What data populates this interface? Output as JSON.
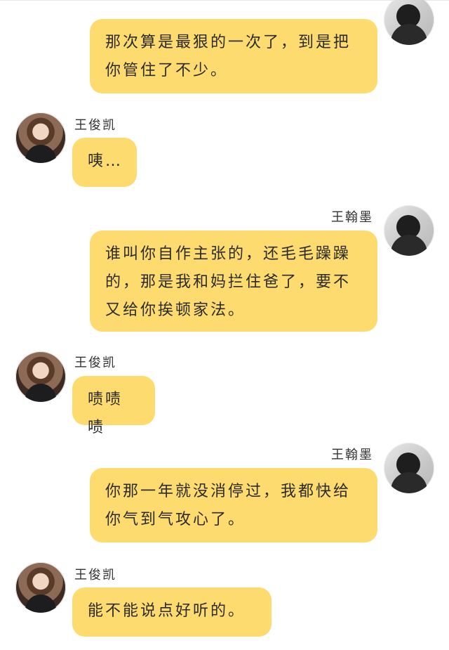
{
  "users": {
    "other": {
      "name": "王俊凯"
    },
    "self": {
      "name": "王翰墨"
    }
  },
  "messages": [
    {
      "text": "那次算是最狠的一次了，到是把你管住了不少。"
    },
    {
      "text": "咦…"
    },
    {
      "text": "谁叫你自作主张的，还毛毛躁躁的，那是我和妈拦住爸了，要不又给你挨顿家法。"
    },
    {
      "text": "啧啧啧"
    },
    {
      "text": "你那一年就没消停过，我都快给你气到气攻心了。"
    },
    {
      "text": "能不能说点好听的。"
    }
  ],
  "colors": {
    "bubble": "#fddb6f",
    "background": "#ffffff"
  }
}
